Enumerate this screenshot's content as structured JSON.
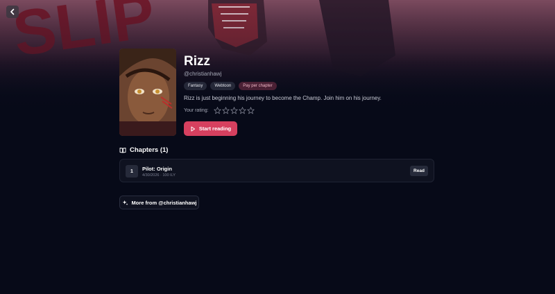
{
  "nav": {
    "back_icon": "chevron-left-icon"
  },
  "series": {
    "title": "Rizz",
    "author": "@christianhawj",
    "tags": [
      "Fantasy",
      "Webtoon",
      "Pay per chapter"
    ],
    "description": "Rizz is just beginning his journey to become the Champ. Join him on his journey.",
    "rating_label": "Your rating:",
    "rating_value": 0,
    "rating_max": 5,
    "start_label": "Start reading"
  },
  "chapters": {
    "heading": "Chapters (1)",
    "items": [
      {
        "number": "1",
        "title": "Pilot: Origin",
        "meta": "4/30/2026 · 100 ILY",
        "action": "Read"
      }
    ]
  },
  "more": {
    "label": "More from @christianhawj"
  },
  "colors": {
    "accent": "#d6405f",
    "background": "#070a18",
    "card": "#0f1220",
    "paid_tag": "#4a2034"
  }
}
